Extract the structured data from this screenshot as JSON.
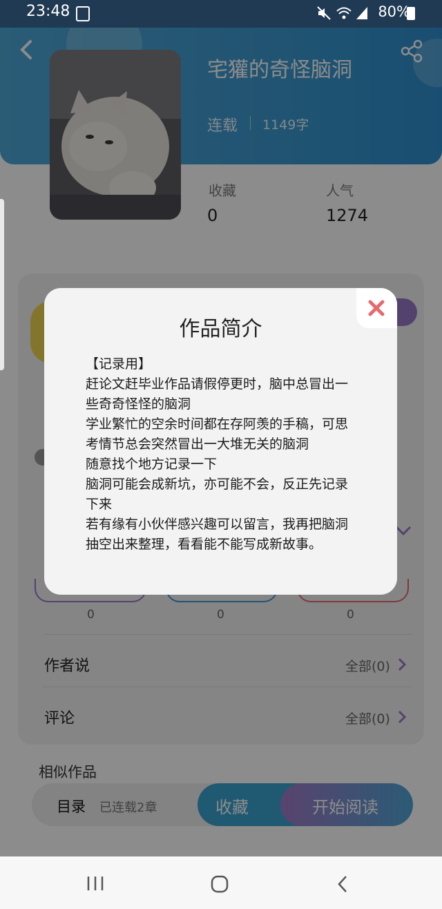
{
  "status_bar": {
    "time": "23:48",
    "battery": "80%"
  },
  "book": {
    "title": "宅獾的奇怪脑洞",
    "status": "连载",
    "word_count": "1149字"
  },
  "stats": {
    "favorites_label": "收藏",
    "favorites_value": "0",
    "popularity_label": "人气",
    "popularity_value": "1274"
  },
  "card": {
    "counts": [
      "0",
      "0",
      "0"
    ],
    "author_says_label": "作者说",
    "author_says_link": "全部(0)",
    "comments_label": "评论",
    "comments_link": "全部(0)"
  },
  "similar_label": "相似作品",
  "bottom_bar": {
    "toc_label": "目录",
    "chapters_label": "已连载2章",
    "favorite_button": "收藏",
    "read_button": "开始阅读"
  },
  "dialog": {
    "title": "作品简介",
    "lines": [
      "【记录用】",
      "赶论文赶毕业作品请假停更时，脑中总冒出一",
      "些奇奇怪怪的脑洞",
      "学业繁忙的空余时间都在存阿羡的手稿，可思",
      "考情节总会突然冒出一大堆无关的脑洞",
      "随意找个地方记录一下",
      "脑洞可能会成新坑，亦可能不会，反正先记录",
      "下来",
      "若有缘有小伙伴感兴趣可以留言，我再把脑洞",
      "抽空出来整理，看看能不能写成新故事。"
    ]
  },
  "colors": {
    "accent_blue": "#3d9ad0",
    "accent_purple": "#9a78c9",
    "close_red": "#e8696d"
  }
}
